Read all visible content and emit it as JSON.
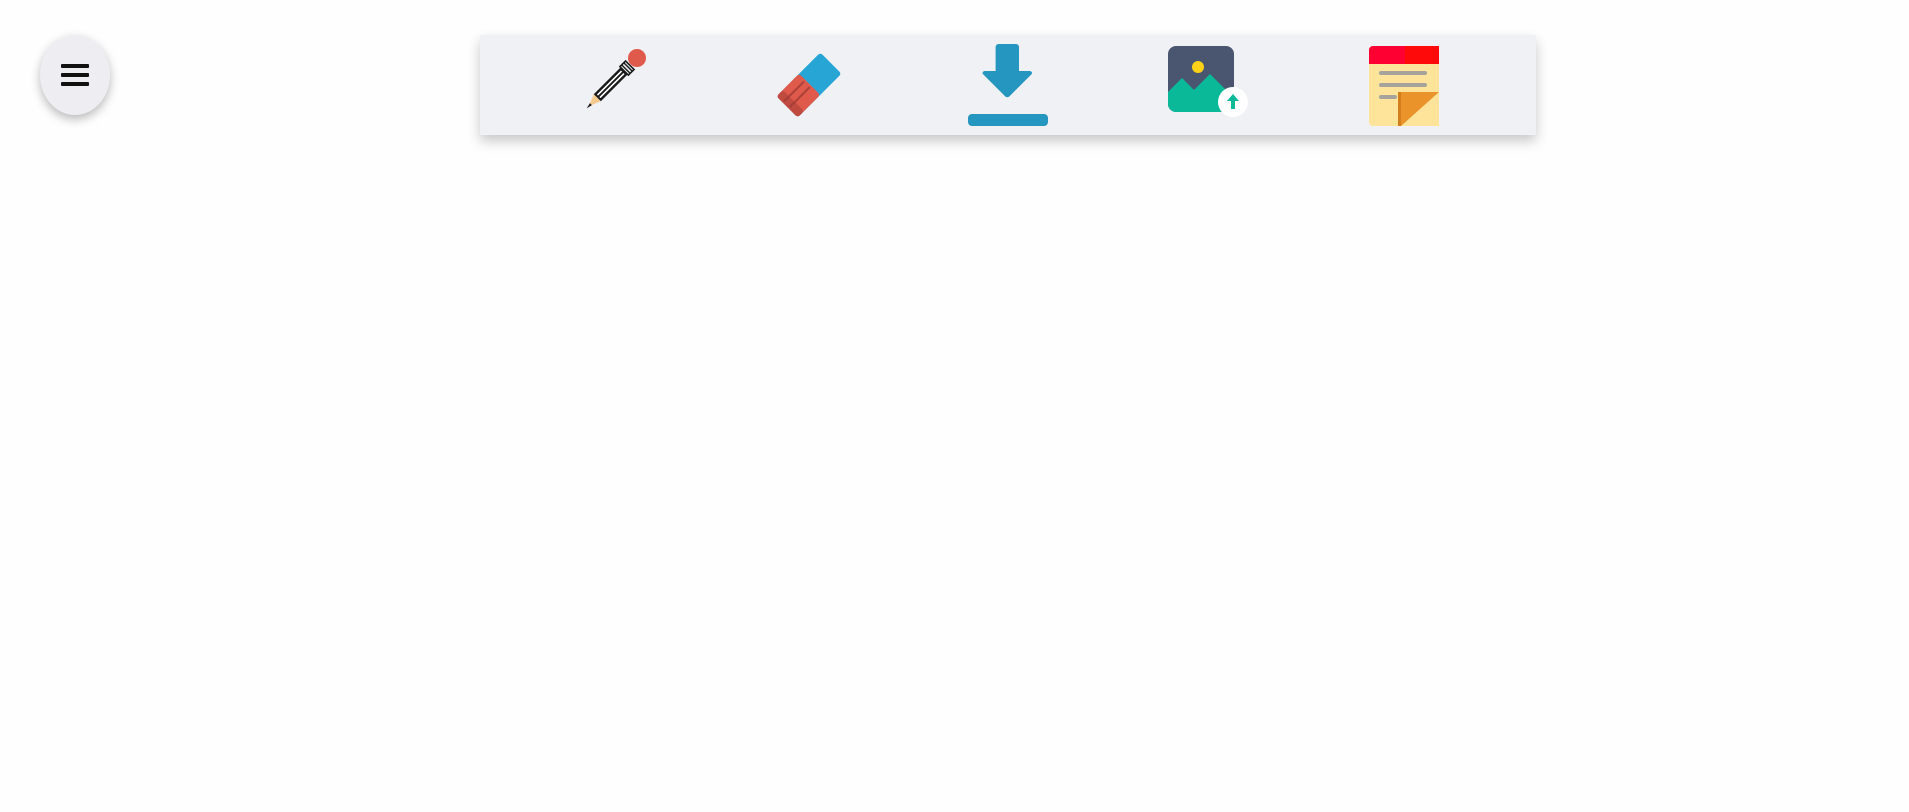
{
  "menu": {
    "icon": "hamburger-menu-icon"
  },
  "toolbar": {
    "tools": [
      {
        "name": "pencil",
        "icon": "pencil-icon"
      },
      {
        "name": "eraser",
        "icon": "eraser-icon"
      },
      {
        "name": "download",
        "icon": "download-icon"
      },
      {
        "name": "upload-image",
        "icon": "image-upload-icon"
      },
      {
        "name": "sticky-note",
        "icon": "sticky-note-icon"
      }
    ]
  },
  "colors": {
    "page_background": "#fefefe",
    "toolbar_background": "#f0f1f5",
    "menu_background": "#eeeef2",
    "download_blue": "#2596c0",
    "eraser_blue": "#27a6d6",
    "eraser_red": "#e05a4c",
    "image_slate": "#4a5670",
    "image_green": "#09b998",
    "note_red": "#ff0033",
    "note_yellow": "#fde49a",
    "note_fold": "#e9932a"
  }
}
